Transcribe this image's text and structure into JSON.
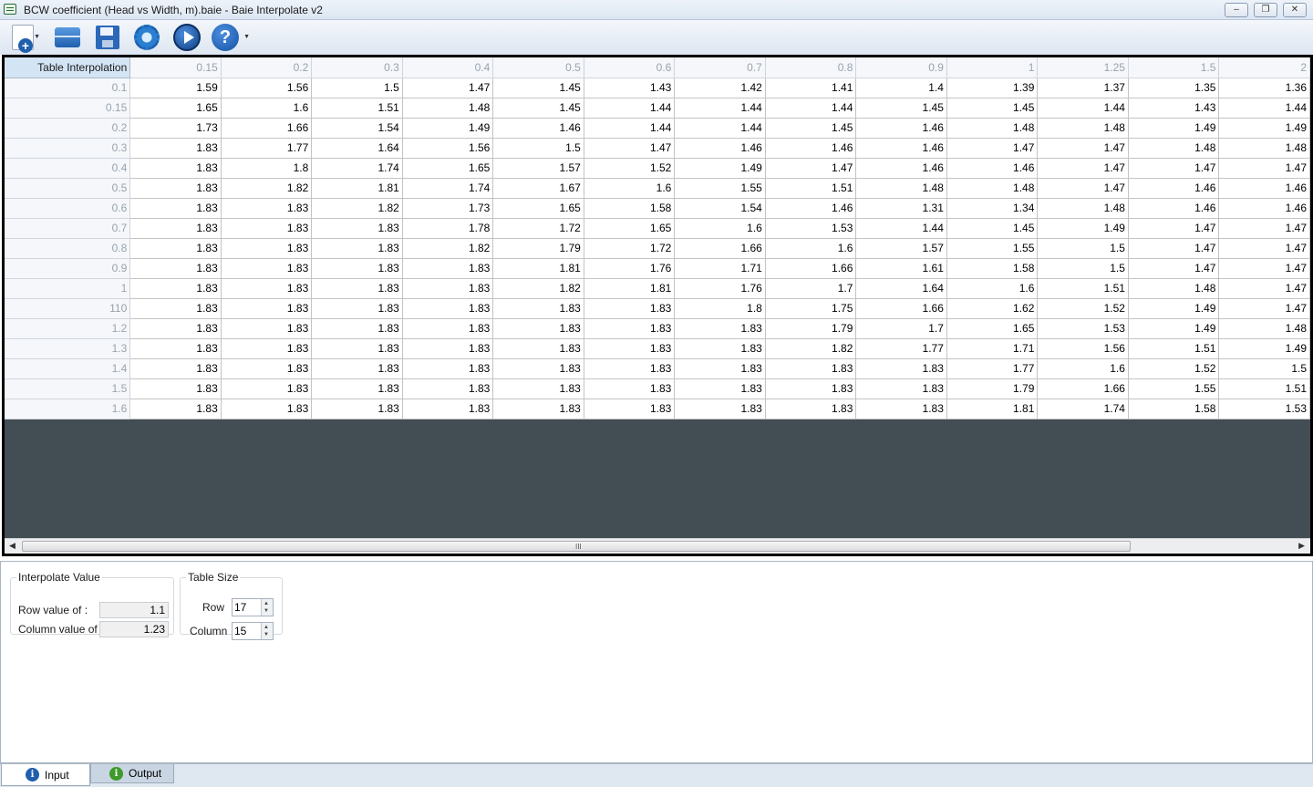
{
  "window": {
    "title": "BCW coefficient (Head vs Width, m).baie - Baie Interpolate v2",
    "minimize_glyph": "–",
    "maximize_glyph": "❐",
    "close_glyph": "✕"
  },
  "toolbar": {
    "buttons": [
      "new-document-icon",
      "open-icon",
      "save-icon",
      "settings-gear-icon",
      "run-play-icon",
      "help-icon"
    ],
    "help_glyph": "?"
  },
  "grid": {
    "corner_label": "Table Interpolation",
    "columns": [
      "0.15",
      "0.2",
      "0.3",
      "0.4",
      "0.5",
      "0.6",
      "0.7",
      "0.8",
      "0.9",
      "1",
      "1.25",
      "1.5",
      "2"
    ],
    "rows": [
      {
        "head": "0.1",
        "cells": [
          "1.59",
          "1.56",
          "1.5",
          "1.47",
          "1.45",
          "1.43",
          "1.42",
          "1.41",
          "1.4",
          "1.39",
          "1.37",
          "1.35",
          "1.36"
        ]
      },
      {
        "head": "0.15",
        "cells": [
          "1.65",
          "1.6",
          "1.51",
          "1.48",
          "1.45",
          "1.44",
          "1.44",
          "1.44",
          "1.45",
          "1.45",
          "1.44",
          "1.43",
          "1.44"
        ]
      },
      {
        "head": "0.2",
        "cells": [
          "1.73",
          "1.66",
          "1.54",
          "1.49",
          "1.46",
          "1.44",
          "1.44",
          "1.45",
          "1.46",
          "1.48",
          "1.48",
          "1.49",
          "1.49"
        ]
      },
      {
        "head": "0.3",
        "cells": [
          "1.83",
          "1.77",
          "1.64",
          "1.56",
          "1.5",
          "1.47",
          "1.46",
          "1.46",
          "1.46",
          "1.47",
          "1.47",
          "1.48",
          "1.48"
        ]
      },
      {
        "head": "0.4",
        "cells": [
          "1.83",
          "1.8",
          "1.74",
          "1.65",
          "1.57",
          "1.52",
          "1.49",
          "1.47",
          "1.46",
          "1.46",
          "1.47",
          "1.47",
          "1.47"
        ]
      },
      {
        "head": "0.5",
        "cells": [
          "1.83",
          "1.82",
          "1.81",
          "1.74",
          "1.67",
          "1.6",
          "1.55",
          "1.51",
          "1.48",
          "1.48",
          "1.47",
          "1.46",
          "1.46"
        ]
      },
      {
        "head": "0.6",
        "cells": [
          "1.83",
          "1.83",
          "1.82",
          "1.73",
          "1.65",
          "1.58",
          "1.54",
          "1.46",
          "1.31",
          "1.34",
          "1.48",
          "1.46",
          "1.46"
        ]
      },
      {
        "head": "0.7",
        "cells": [
          "1.83",
          "1.83",
          "1.83",
          "1.78",
          "1.72",
          "1.65",
          "1.6",
          "1.53",
          "1.44",
          "1.45",
          "1.49",
          "1.47",
          "1.47"
        ]
      },
      {
        "head": "0.8",
        "cells": [
          "1.83",
          "1.83",
          "1.83",
          "1.82",
          "1.79",
          "1.72",
          "1.66",
          "1.6",
          "1.57",
          "1.55",
          "1.5",
          "1.47",
          "1.47"
        ]
      },
      {
        "head": "0.9",
        "cells": [
          "1.83",
          "1.83",
          "1.83",
          "1.83",
          "1.81",
          "1.76",
          "1.71",
          "1.66",
          "1.61",
          "1.58",
          "1.5",
          "1.47",
          "1.47"
        ]
      },
      {
        "head": "1",
        "cells": [
          "1.83",
          "1.83",
          "1.83",
          "1.83",
          "1.82",
          "1.81",
          "1.76",
          "1.7",
          "1.64",
          "1.6",
          "1.51",
          "1.48",
          "1.47"
        ]
      },
      {
        "head": "110",
        "cells": [
          "1.83",
          "1.83",
          "1.83",
          "1.83",
          "1.83",
          "1.83",
          "1.8",
          "1.75",
          "1.66",
          "1.62",
          "1.52",
          "1.49",
          "1.47"
        ]
      },
      {
        "head": "1.2",
        "cells": [
          "1.83",
          "1.83",
          "1.83",
          "1.83",
          "1.83",
          "1.83",
          "1.83",
          "1.79",
          "1.7",
          "1.65",
          "1.53",
          "1.49",
          "1.48"
        ]
      },
      {
        "head": "1.3",
        "cells": [
          "1.83",
          "1.83",
          "1.83",
          "1.83",
          "1.83",
          "1.83",
          "1.83",
          "1.82",
          "1.77",
          "1.71",
          "1.56",
          "1.51",
          "1.49"
        ]
      },
      {
        "head": "1.4",
        "cells": [
          "1.83",
          "1.83",
          "1.83",
          "1.83",
          "1.83",
          "1.83",
          "1.83",
          "1.83",
          "1.83",
          "1.77",
          "1.6",
          "1.52",
          "1.5"
        ]
      },
      {
        "head": "1.5",
        "cells": [
          "1.83",
          "1.83",
          "1.83",
          "1.83",
          "1.83",
          "1.83",
          "1.83",
          "1.83",
          "1.83",
          "1.79",
          "1.66",
          "1.55",
          "1.51"
        ]
      },
      {
        "head": "1.6",
        "cells": [
          "1.83",
          "1.83",
          "1.83",
          "1.83",
          "1.83",
          "1.83",
          "1.83",
          "1.83",
          "1.83",
          "1.81",
          "1.74",
          "1.58",
          "1.53"
        ]
      }
    ],
    "scroll_grip": "III"
  },
  "interpolate": {
    "legend": "Interpolate Value",
    "row_label": "Row value of :",
    "row_value": "1.1",
    "col_label": "Column value of :",
    "col_value": "1.23"
  },
  "table_size": {
    "legend": "Table Size",
    "row_label": "Row",
    "row_value": "17",
    "col_label": "Column",
    "col_value": "15"
  },
  "tabs": {
    "input_label": "Input",
    "output_label": "Output",
    "info_glyph": "i"
  }
}
